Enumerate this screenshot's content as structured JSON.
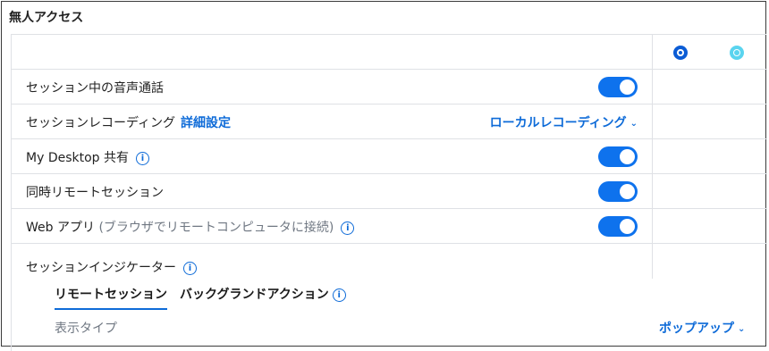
{
  "section_title": "無人アクセス",
  "rows": [
    {
      "label": "セッション中の音声通話"
    },
    {
      "label": "セッションレコーディング",
      "link": "詳細設定",
      "dropdown": "ローカルレコーディング"
    },
    {
      "label": "My Desktop 共有"
    },
    {
      "label": "同時リモートセッション"
    },
    {
      "label": "Web アプリ",
      "note": "(ブラウザでリモートコンピュータに接続)"
    }
  ],
  "toggles": {
    "voice_call": true,
    "my_desktop": true,
    "concurrent": true,
    "web_app": true
  },
  "indicator": {
    "label": "セッションインジケーター",
    "tabs": [
      "リモートセッション",
      "バックグランドアクション"
    ],
    "active_tab": "リモートセッション",
    "display_type_label": "表示タイプ",
    "display_type_value": "ポップアップ"
  },
  "icons": {
    "info": "i",
    "chevron": "⌄"
  },
  "colors": {
    "accent": "#0e6bd8",
    "toggle_on": "#0e72ed",
    "column_icon_1": "#0b5cd5",
    "column_icon_2": "#5ad4ef"
  }
}
